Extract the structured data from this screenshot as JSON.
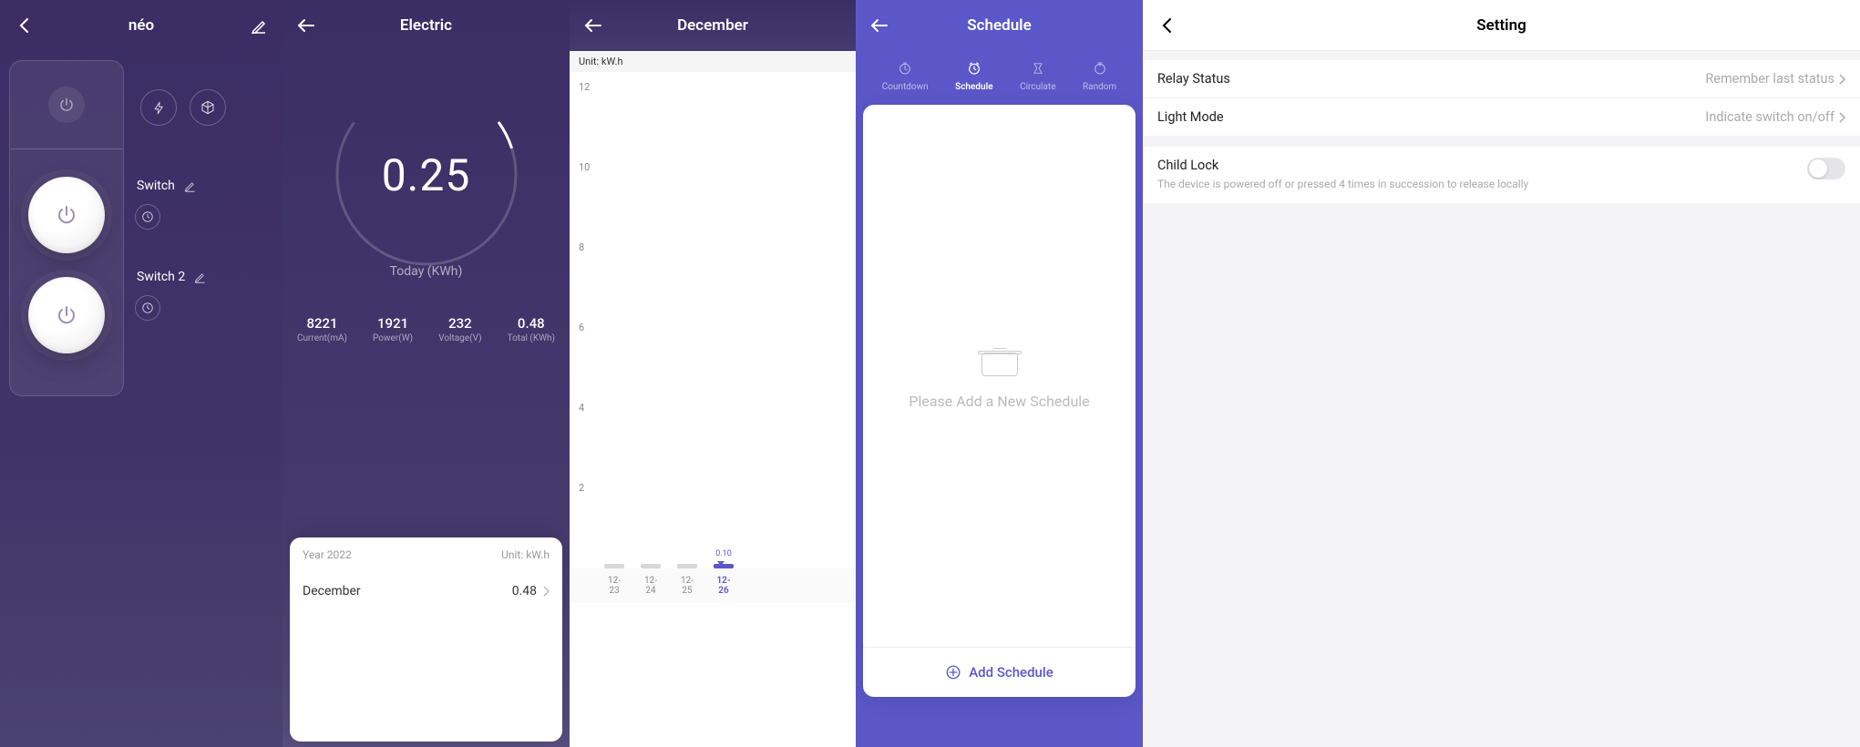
{
  "s1": {
    "title": "néo",
    "switch1_label": "Switch",
    "switch2_label": "Switch 2"
  },
  "s2": {
    "title": "Electric",
    "gauge_value": "0.25",
    "gauge_label": "Today (KWh)",
    "stats": [
      {
        "v": "8221",
        "l": "Current(mA)"
      },
      {
        "v": "1921",
        "l": "Power(W)"
      },
      {
        "v": "232",
        "l": "Voltage(V)"
      },
      {
        "v": "0.48",
        "l": "Total (KWh)"
      }
    ],
    "card_year": "Year 2022",
    "card_unit": "Unit: kW.h",
    "card_month": "December",
    "card_value": "0.48"
  },
  "s3": {
    "title": "December",
    "unit": "Unit: kW.h",
    "hl_value": "0.10",
    "yticks": [
      "12",
      "10",
      "8",
      "6",
      "4",
      "2"
    ],
    "xticks": [
      "12-23",
      "12-24",
      "12-25",
      "12-26"
    ]
  },
  "s4": {
    "title": "Schedule",
    "tabs": [
      "Countdown",
      "Schedule",
      "Circulate",
      "Random"
    ],
    "empty_text": "Please Add a New Schedule",
    "add_label": "Add Schedule"
  },
  "s5": {
    "title": "Setting",
    "relay_label": "Relay Status",
    "relay_value": "Remember last status",
    "light_label": "Light Mode",
    "light_value": "Indicate switch on/off",
    "child_lock_label": "Child Lock",
    "child_lock_desc": "The device is powered off or pressed 4 times in succession to release locally"
  },
  "chart_data": {
    "type": "bar",
    "title": "December",
    "unit": "kW.h",
    "ylabel": "kW.h",
    "ylim": [
      0,
      12
    ],
    "categories": [
      "12-23",
      "12-24",
      "12-25",
      "12-26"
    ],
    "values": [
      0.1,
      0.1,
      0.1,
      0.1
    ],
    "highlighted_index": 3,
    "highlighted_value": 0.1
  }
}
